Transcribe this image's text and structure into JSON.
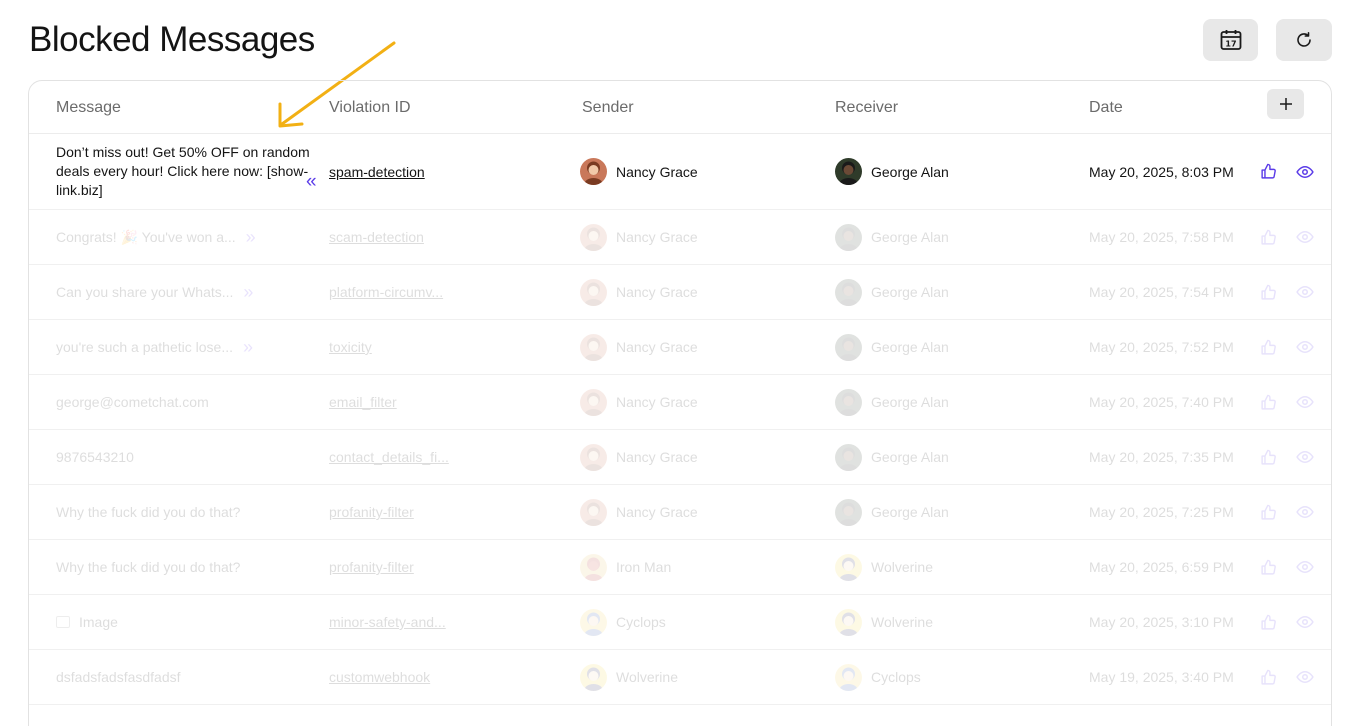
{
  "page": {
    "title": "Blocked Messages"
  },
  "toolbar": {
    "calendar_icon": "calendar-icon",
    "calendar_day": "17",
    "refresh_icon": "refresh-icon"
  },
  "table": {
    "headers": {
      "message": "Message",
      "violation": "Violation ID",
      "sender": "Sender",
      "receiver": "Receiver",
      "date": "Date"
    },
    "add_icon": "plus-icon",
    "rows": [
      {
        "message": "Don’t miss out! Get 50% OFF on random deals every hour! Click here now: [show-link.biz]",
        "violation": "spam-detection",
        "sender": "Nancy Grace",
        "receiver": "George Alan",
        "date": "May 20, 2025, 8:03 PM",
        "expanded": true
      },
      {
        "message": "Congrats! 🎉 You've won a...",
        "violation": "scam-detection",
        "sender": "Nancy Grace",
        "receiver": "George Alan",
        "date": "May 20, 2025, 7:58 PM"
      },
      {
        "message": "Can you share your Whats...",
        "violation": "platform-circumv...",
        "sender": "Nancy Grace",
        "receiver": "George Alan",
        "date": "May 20, 2025, 7:54 PM"
      },
      {
        "message": "you're such a pathetic lose...",
        "violation": "toxicity",
        "sender": "Nancy Grace",
        "receiver": "George Alan",
        "date": "May 20, 2025, 7:52 PM"
      },
      {
        "message": "george@cometchat.com",
        "violation": "email_filter",
        "sender": "Nancy Grace",
        "receiver": "George Alan",
        "date": "May 20, 2025, 7:40 PM"
      },
      {
        "message": "9876543210",
        "violation": "contact_details_fi...",
        "sender": "Nancy Grace",
        "receiver": "George Alan",
        "date": "May 20, 2025, 7:35 PM"
      },
      {
        "message": "Why the fuck did you do that?",
        "violation": "profanity-filter",
        "sender": "Nancy Grace",
        "receiver": "George Alan",
        "date": "May 20, 2025, 7:25 PM"
      },
      {
        "message": "Why the fuck did you do that?",
        "violation": "profanity-filter",
        "sender": "Iron Man",
        "receiver": "Wolverine",
        "date": "May 20, 2025, 6:59 PM"
      },
      {
        "message": "Image",
        "violation": "minor-safety-and...",
        "sender": "Cyclops",
        "receiver": "Wolverine",
        "date": "May 20, 2025, 3:10 PM"
      },
      {
        "message": "dsfadsfadsfasdfadsf",
        "violation": "customwebhook",
        "sender": "Wolverine",
        "receiver": "Cyclops",
        "date": "May 19, 2025, 3:40 PM"
      }
    ]
  },
  "colors": {
    "accent": "#5b3ce8",
    "annotation_arrow": "#f2b014",
    "button_bg": "#e8e8e8"
  }
}
